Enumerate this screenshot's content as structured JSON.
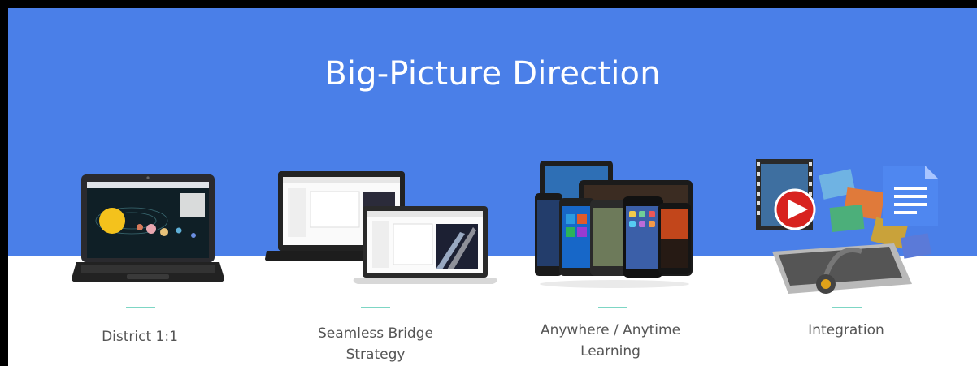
{
  "header": {
    "title": "Big-Picture Direction"
  },
  "items": [
    {
      "label_line1": "District 1:1",
      "label_line2": "",
      "icon": "laptop-solar-system-icon"
    },
    {
      "label_line1": "Seamless Bridge",
      "label_line2": "Strategy",
      "icon": "two-laptops-icon"
    },
    {
      "label_line1": "Anywhere / Anytime",
      "label_line2": "Learning",
      "icon": "mobile-devices-icon"
    },
    {
      "label_line1": "Integration",
      "label_line2": "",
      "icon": "media-integration-icon"
    }
  ],
  "colors": {
    "band": "#4a7fe8",
    "accent_rule": "#7dd6c4",
    "label_text": "#555555"
  }
}
